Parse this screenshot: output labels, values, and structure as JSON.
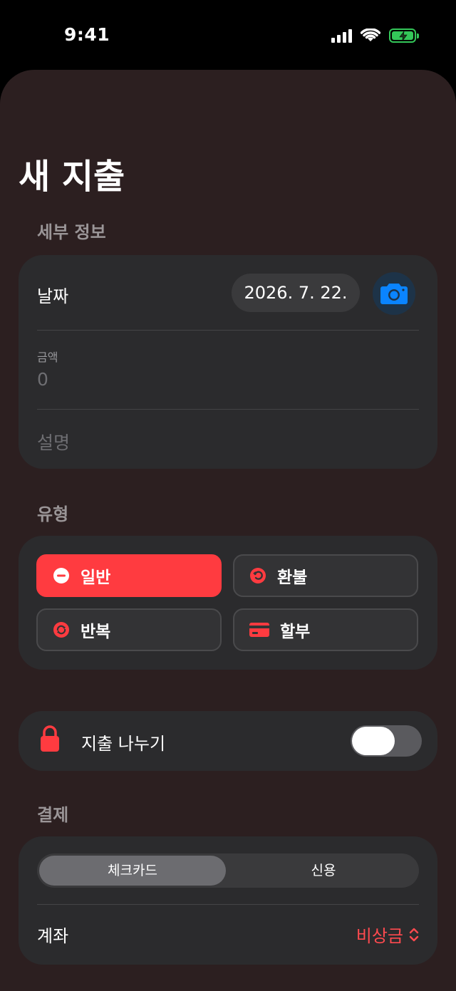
{
  "status_bar": {
    "time": "9:41"
  },
  "page": {
    "title": "새 지출"
  },
  "details": {
    "header": "세부 정보",
    "date_label": "날짜",
    "date_value": "2026. 7. 22.",
    "amount_label": "금액",
    "amount_placeholder": "0",
    "description_placeholder": "설명"
  },
  "type": {
    "header": "유형",
    "options": [
      {
        "label": "일반",
        "icon": "minus-circle-icon",
        "selected": true
      },
      {
        "label": "환불",
        "icon": "refund-arrow-icon",
        "selected": false
      },
      {
        "label": "반복",
        "icon": "repeat-icon",
        "selected": false
      },
      {
        "label": "할부",
        "icon": "credit-card-icon",
        "selected": false
      }
    ]
  },
  "split": {
    "label": "지출 나누기",
    "icon": "lock-icon",
    "enabled": false
  },
  "payment": {
    "header": "결제",
    "methods": [
      "체크카드",
      "신용"
    ],
    "selected_method": "체크카드",
    "account_label": "계좌",
    "account_value": "비상금"
  },
  "colors": {
    "accent": "#ff3b40",
    "camera": "#0a84ff",
    "battery": "#34c759",
    "background": "#2c1f20",
    "card": "#2b2b2d"
  }
}
